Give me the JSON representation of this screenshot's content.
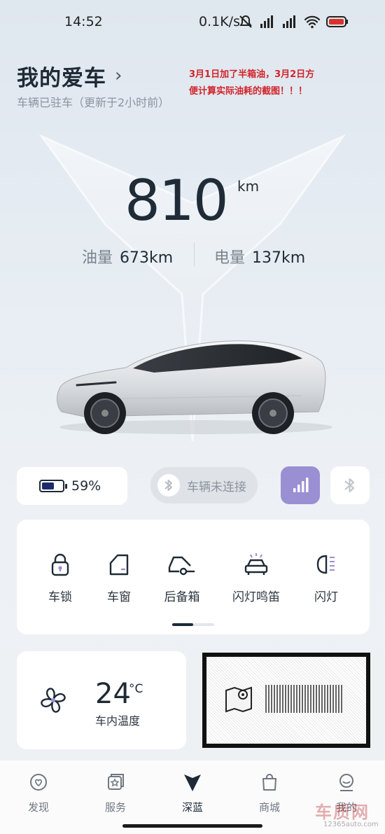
{
  "status_bar": {
    "time": "14:52",
    "network_speed": "0.1K/s",
    "icons": [
      "mute-icon",
      "signal-hd-1-icon",
      "signal-hd-2-icon",
      "wifi-icon",
      "battery-low-icon"
    ]
  },
  "header": {
    "title": "我的爱车",
    "subtitle": "车辆已驻车（更新于2小时前）",
    "annotation_line1": "3月1日加了半箱油，3月2日方",
    "annotation_line2": "便计算实际油耗的截图！！！"
  },
  "range": {
    "total": "810",
    "unit": "km",
    "fuel_label": "油量",
    "fuel_value": "673km",
    "elec_label": "电量",
    "elec_value": "137km"
  },
  "quick": {
    "battery_percent_text": "59%",
    "battery_level": 0.59,
    "connection_text": "车辆未连接"
  },
  "controls": [
    {
      "label": "车锁",
      "icon": "lock-icon"
    },
    {
      "label": "车窗",
      "icon": "window-icon"
    },
    {
      "label": "后备箱",
      "icon": "trunk-icon"
    },
    {
      "label": "闪灯鸣笛",
      "icon": "flash-horn-icon"
    },
    {
      "label": "闪灯",
      "icon": "headlight-icon"
    }
  ],
  "climate": {
    "temperature": "24",
    "unit": "°C",
    "label": "车内温度"
  },
  "nav": [
    {
      "label": "发现",
      "icon": "discover-icon"
    },
    {
      "label": "服务",
      "icon": "service-icon"
    },
    {
      "label": "深蓝",
      "icon": "deepblue-logo-icon"
    },
    {
      "label": "商城",
      "icon": "shop-bag-icon"
    },
    {
      "label": "我的",
      "icon": "profile-icon"
    }
  ],
  "watermark": {
    "text": "车质网",
    "site": "12365auto.com"
  },
  "colors": {
    "accent_purple": "#9b8fd3",
    "annotation_red": "#d2232a",
    "text_dark": "#1e2a36"
  }
}
